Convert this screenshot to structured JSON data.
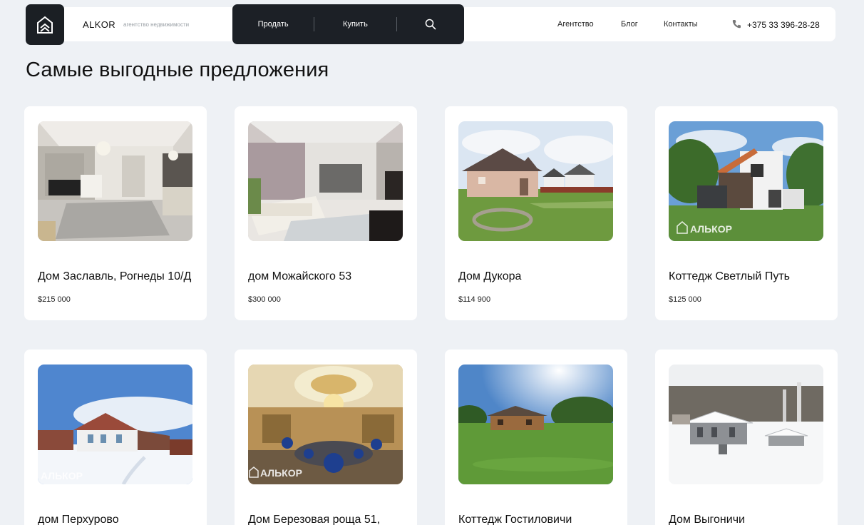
{
  "header": {
    "brand": "ALKOR",
    "brand_sub": "агентство недвижимости",
    "nav": {
      "sell": "Продать",
      "buy": "Купить"
    },
    "links": {
      "agency": "Агентство",
      "blog": "Блог",
      "contacts": "Контакты"
    },
    "phone": "+375 33 396-28-28"
  },
  "page_title": "Самые выгодные предложения",
  "watermark": "АЛЬКОР",
  "listings": [
    {
      "name": "Дом Заславль, Рогнеды 10/Д",
      "price": "$215 000"
    },
    {
      "name": "дом Можайского 53",
      "price": "$300 000"
    },
    {
      "name": "Дом Дукора",
      "price": "$114 900"
    },
    {
      "name": "Коттедж Светлый Путь",
      "price": "$125 000"
    },
    {
      "name": "дом Перхурово",
      "price": ""
    },
    {
      "name": "Дом Березовая роща 51,",
      "price": ""
    },
    {
      "name": "Коттедж Гостиловичи",
      "price": ""
    },
    {
      "name": "Дом Выгоничи",
      "price": ""
    }
  ]
}
